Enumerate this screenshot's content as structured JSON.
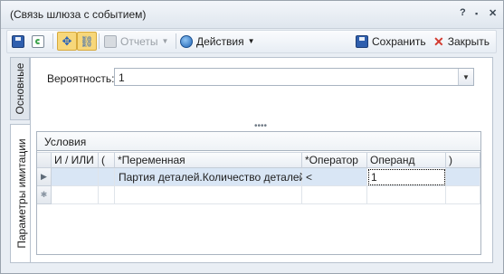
{
  "window": {
    "title": "(Связь шлюза с событием)",
    "controls": [
      "?",
      "▪",
      "✕"
    ]
  },
  "toolbar": {
    "reports_label": "Отчеты",
    "actions_label": "Действия",
    "save_label": "Сохранить",
    "close_label": "Закрыть"
  },
  "tabs": {
    "main": "Основные",
    "simulation": "Параметры имитации"
  },
  "probability": {
    "label": "Вероятность:",
    "value": "1"
  },
  "conditions": {
    "title": "Условия",
    "columns": [
      "И / ИЛИ",
      "(",
      "*Переменная",
      "*Оператор",
      "Операнд",
      ")"
    ],
    "rows": [
      {
        "and_or": "",
        "open": "",
        "variable": "Партия деталей.Количество деталей",
        "operator": "<",
        "operand": "1",
        "close": ""
      }
    ],
    "new_row_marker": "✱"
  },
  "colors": {
    "accent": "#f7d77a",
    "selection": "#d9e6f5",
    "close_red": "#d23a2f"
  }
}
